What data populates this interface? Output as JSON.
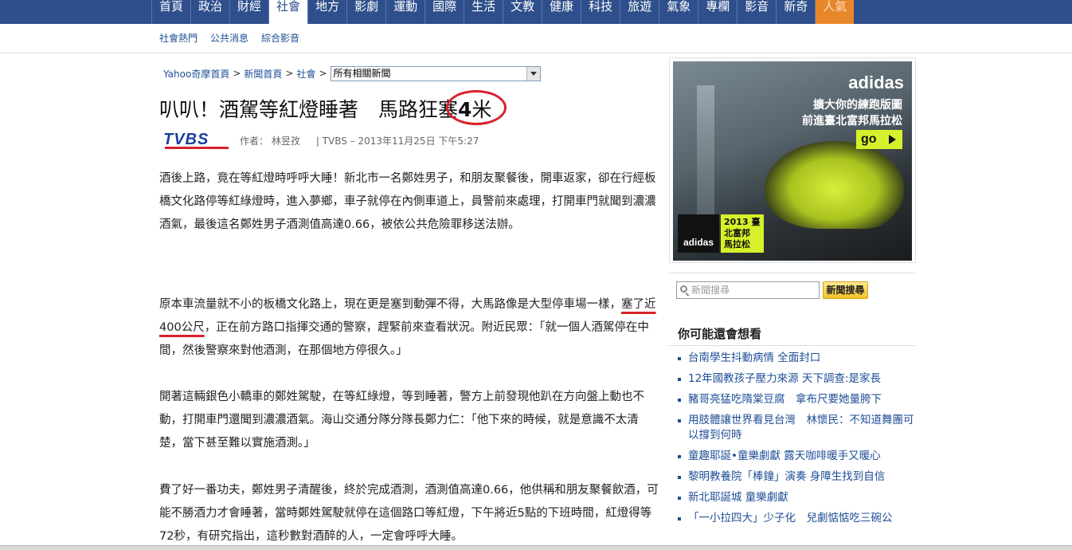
{
  "topnav": {
    "tabs": [
      {
        "label": "首頁"
      },
      {
        "label": "政治"
      },
      {
        "label": "財經"
      },
      {
        "label": "社會",
        "active": true
      },
      {
        "label": "地方"
      },
      {
        "label": "影劇"
      },
      {
        "label": "運動"
      },
      {
        "label": "國際"
      },
      {
        "label": "生活"
      },
      {
        "label": "文教"
      },
      {
        "label": "健康"
      },
      {
        "label": "科技"
      },
      {
        "label": "旅遊"
      },
      {
        "label": "氣象"
      },
      {
        "label": "專欄"
      },
      {
        "label": "影音"
      },
      {
        "label": "新奇"
      },
      {
        "label": "人氣",
        "hot": true
      }
    ]
  },
  "subnav": {
    "items": [
      "社會熱門",
      "公共消息",
      "綜合影音"
    ]
  },
  "breadcrumb": {
    "home": "Yahoo奇摩首頁",
    "news": "新聞首頁",
    "section": "社會",
    "sep": ">",
    "select_value": "所有相關新聞"
  },
  "article": {
    "title_main": "叭叭！酒駕等紅燈睡著　馬路狂塞",
    "title_num": "4",
    "title_unit": "米",
    "source_logo": "TVBS",
    "author": "作者： 林昱孜",
    "meta": "| TVBS – 2013年11月25日 下午5:27",
    "p1": "酒後上路，竟在等紅燈時呼呼大睡！新北市一名鄭姓男子，和朋友聚餐後，開車返家，卻在行經板橋文化路停等紅綠燈時，進入夢鄉，車子就停在內側車道上，員警前來處理，打開車門就聞到濃濃酒氣，最後這名鄭姓男子酒測值高達0.66，被依公共危險罪移送法辦。",
    "p2_a": "原本車流量就不小的板橋文化路上，現在更是塞到動彈不得，大馬路像是大型停車場一樣，",
    "p2_hl": "塞了近400公尺",
    "p2_b": "，正在前方路口指揮交通的警察，趕緊前來查看狀況。附近民眾：「就一個人酒駕停在中間，然後警察來對他酒測，在那個地方停很久。」",
    "p3": "開著這輛銀色小轎車的鄭姓駕駛，在等紅綠燈，等到睡著，警方上前發現他趴在方向盤上動也不動，打開車門還聞到濃濃酒氣。海山交通分隊分隊長鄭力仁：「他下來的時候，就是意識不太清楚，當下甚至難以實施酒測。」",
    "p4": "費了好一番功夫，鄭姓男子清醒後，終於完成酒測，酒測值高達0.66，他供稱和朋友聚餐飲酒，可能不勝酒力才會睡著，當時鄭姓駕駛就停在這個路口等紅燈，下午將近5點的下班時間，紅燈得等72秒，有研究指出，這秒數對酒醉的人，一定會呼呼大睡。"
  },
  "ad": {
    "brand": "adidas",
    "line1": "擴大你的練跑版圖",
    "line2": "前進臺北富邦馬拉松",
    "cta": "go",
    "badge_brand": "adidas",
    "badge_text": "2013 臺北富邦 馬拉松"
  },
  "search": {
    "placeholder": "新聞搜尋",
    "button": "新聞搜尋"
  },
  "related": {
    "header": "你可能還會想看",
    "items": [
      "台南學生抖動病情 全面封口",
      "12年國教孩子壓力來源 天下調查:是家長",
      "豬哥亮猛吃隋棠豆腐　拿布尺要她量胯下",
      "用肢體讓世界看見台灣　林懷民：不知道舞團可以撐到何時",
      "童趣耶誕•童樂劇獻 露天咖啡暖手又暖心",
      "黎明教養院「棒鐘」演奏 身障生找到自信",
      "新北耶誕城 童樂劇獻",
      "「一小拉四大」少子化　兒劇惦惦吃三碗公"
    ]
  },
  "colors": {
    "nav_bg": "#2e4f8b",
    "link": "#1f4e96",
    "highlight": "#d8222b",
    "hot_tab": "#e8862a"
  }
}
